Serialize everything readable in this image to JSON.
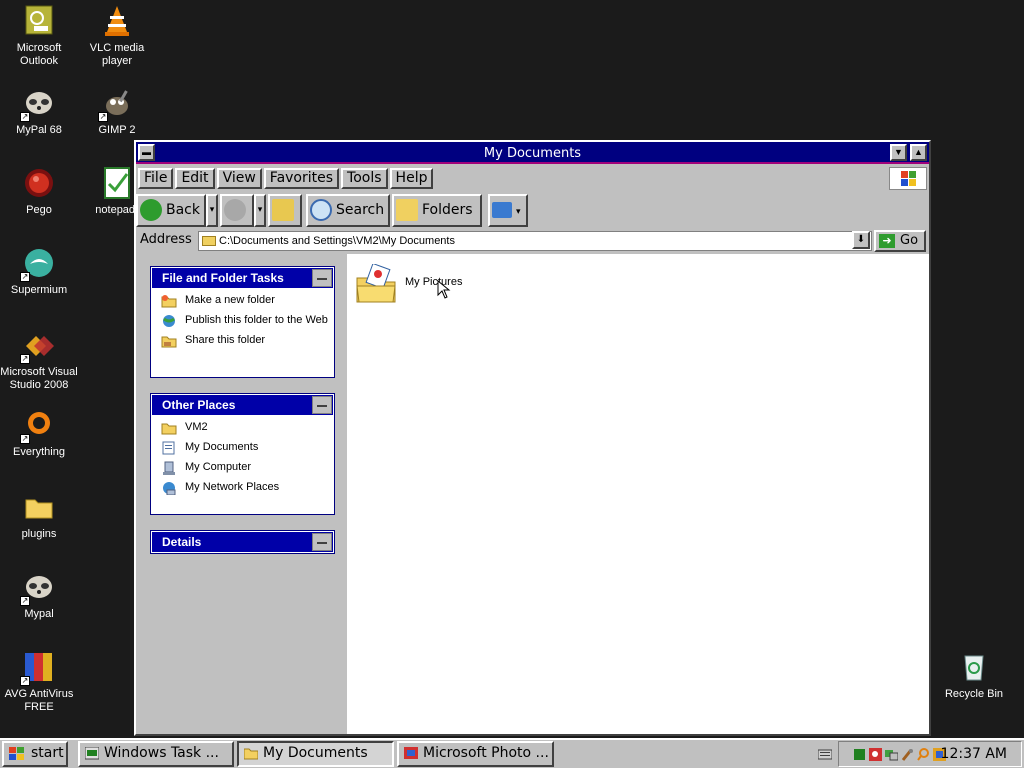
{
  "desktop": {
    "icons": [
      {
        "label": "Microsoft Outlook"
      },
      {
        "label": "VLC media player"
      },
      {
        "label": "MyPal 68"
      },
      {
        "label": "GIMP 2"
      },
      {
        "label": "Pego"
      },
      {
        "label": "notepad-"
      },
      {
        "label": "Supermium"
      },
      {
        "label": "Microsoft Visual Studio 2008"
      },
      {
        "label": "Everything"
      },
      {
        "label": "plugins"
      },
      {
        "label": "Mypal"
      },
      {
        "label": "AVG AntiVirus FREE"
      },
      {
        "label": "Recycle Bin"
      }
    ]
  },
  "window": {
    "title": "My Documents",
    "menu": [
      "File",
      "Edit",
      "View",
      "Favorites",
      "Tools",
      "Help"
    ],
    "toolbar": {
      "back": "Back",
      "search": "Search",
      "folders": "Folders"
    },
    "address": {
      "label": "Address",
      "value": "C:\\Documents and Settings\\VM2\\My Documents",
      "go": "Go"
    },
    "tasks_panel": {
      "title": "File and Folder Tasks",
      "items": [
        "Make a new folder",
        "Publish this folder to the Web",
        "Share this folder"
      ]
    },
    "places_panel": {
      "title": "Other Places",
      "items": [
        "VM2",
        "My Documents",
        "My Computer",
        "My Network Places"
      ]
    },
    "details_panel": {
      "title": "Details"
    },
    "files": [
      {
        "name": "My Pictures"
      }
    ]
  },
  "taskbar": {
    "start": "start",
    "tasks": [
      "Windows Task ...",
      "My Documents",
      "Microsoft Photo ..."
    ],
    "clock": "12:37 AM"
  }
}
